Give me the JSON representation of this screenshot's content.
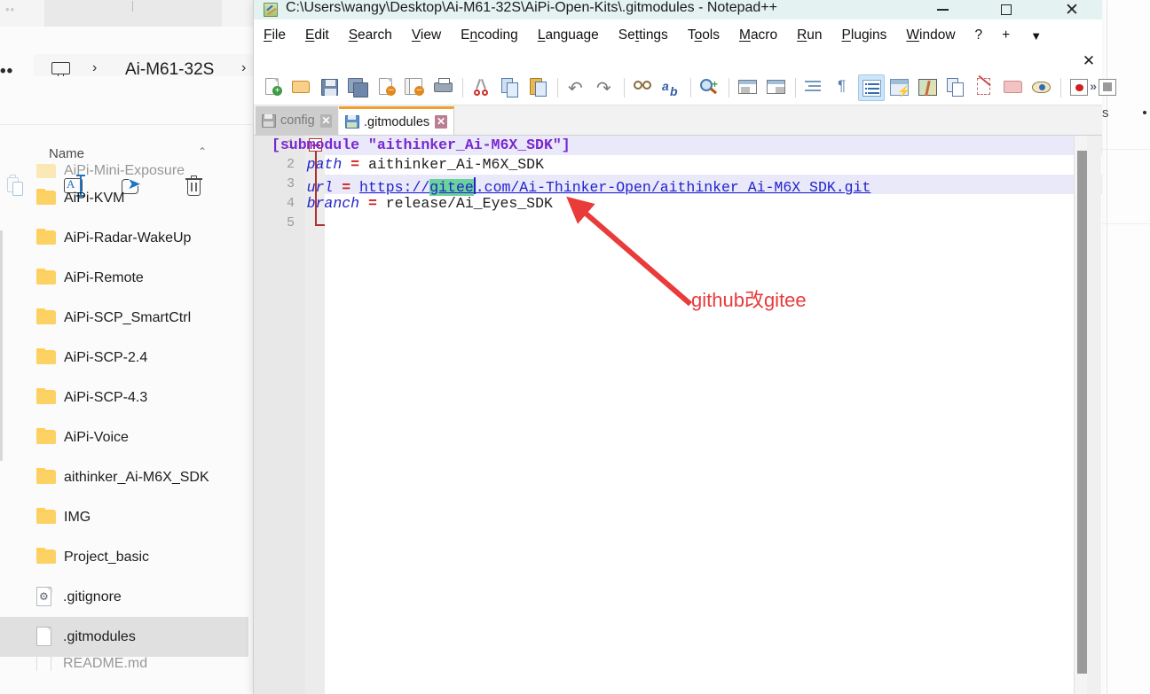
{
  "explorer": {
    "breadcrumb": {
      "overflow_label": "...",
      "monitor_icon": "monitor-icon",
      "current": "Ai-M61-32S",
      "chevron": "›"
    },
    "commands": [
      {
        "name": "paste",
        "icon": "paste-icon"
      },
      {
        "name": "rename",
        "icon": "rename-icon"
      },
      {
        "name": "share",
        "icon": "share-icon"
      },
      {
        "name": "delete",
        "icon": "delete-icon"
      }
    ],
    "column_header": {
      "name_label": "Name",
      "sort_caret": "⌃"
    },
    "items": [
      {
        "label": "AiPi-Mini-Exposure",
        "type": "folder",
        "clipped": true,
        "selected": false
      },
      {
        "label": "AiPi-KVM",
        "type": "folder",
        "selected": false
      },
      {
        "label": "AiPi-Radar-WakeUp",
        "type": "folder",
        "selected": false
      },
      {
        "label": "AiPi-Remote",
        "type": "folder",
        "selected": false
      },
      {
        "label": "AiPi-SCP_SmartCtrl",
        "type": "folder",
        "selected": false
      },
      {
        "label": "AiPi-SCP-2.4",
        "type": "folder",
        "selected": false
      },
      {
        "label": "AiPi-SCP-4.3",
        "type": "folder",
        "selected": false
      },
      {
        "label": "AiPi-Voice",
        "type": "folder",
        "selected": false
      },
      {
        "label": "aithinker_Ai-M6X_SDK",
        "type": "folder",
        "selected": false
      },
      {
        "label": "IMG",
        "type": "folder",
        "selected": false
      },
      {
        "label": "Project_basic",
        "type": "folder",
        "selected": false
      },
      {
        "label": ".gitignore",
        "type": "config-file",
        "selected": false
      },
      {
        "label": ".gitmodules",
        "type": "file",
        "selected": true
      },
      {
        "label": "README.md",
        "type": "file",
        "clipped": true,
        "selected": false
      }
    ]
  },
  "background_right": {
    "text_fragment": "s"
  },
  "notepad": {
    "title": "C:\\Users\\wangy\\Desktop\\Ai-M61-32S\\AiPi-Open-Kits\\.gitmodules - Notepad++",
    "app_icon": "notepadpp-icon",
    "window_buttons": {
      "minimize": "minimize-icon",
      "maximize": "maximize-icon",
      "close": "✕"
    },
    "doc_close_label": "✕",
    "menu": [
      {
        "label": "File",
        "mnemonic": "F"
      },
      {
        "label": "Edit",
        "mnemonic": "E"
      },
      {
        "label": "Search",
        "mnemonic": "S"
      },
      {
        "label": "View",
        "mnemonic": "V"
      },
      {
        "label": "Encoding",
        "mnemonic": "n"
      },
      {
        "label": "Language",
        "mnemonic": "L"
      },
      {
        "label": "Settings",
        "mnemonic": "t"
      },
      {
        "label": "Tools",
        "mnemonic": "o"
      },
      {
        "label": "Macro",
        "mnemonic": "M"
      },
      {
        "label": "Run",
        "mnemonic": "R"
      },
      {
        "label": "Plugins",
        "mnemonic": "P"
      },
      {
        "label": "Window",
        "mnemonic": "W"
      },
      {
        "label": "?",
        "mnemonic": ""
      },
      {
        "label": "+",
        "mnemonic": ""
      }
    ],
    "menu_caret": "▼",
    "toolbar": {
      "overflow_label": "»",
      "buttons": [
        {
          "name": "new-file-icon"
        },
        {
          "name": "open-file-icon"
        },
        {
          "name": "save-icon"
        },
        {
          "name": "save-all-icon"
        },
        {
          "name": "close-file-icon"
        },
        {
          "name": "close-all-files-icon"
        },
        {
          "name": "print-icon"
        },
        {
          "name": "cut-icon"
        },
        {
          "name": "copy-icon"
        },
        {
          "name": "paste-icon"
        },
        {
          "name": "undo-icon"
        },
        {
          "name": "redo-icon"
        },
        {
          "name": "find-icon"
        },
        {
          "name": "replace-icon"
        },
        {
          "name": "zoom-in-icon"
        },
        {
          "name": "zoom-out-icon"
        },
        {
          "name": "sync-vertical-icon"
        },
        {
          "name": "sync-horizontal-icon"
        },
        {
          "name": "word-wrap-icon"
        },
        {
          "name": "show-all-chars-icon"
        },
        {
          "name": "indent-guide-icon"
        },
        {
          "name": "user-defined-dialog-icon"
        },
        {
          "name": "document-map-icon"
        },
        {
          "name": "function-list-icon"
        },
        {
          "name": "document-switcher-icon"
        },
        {
          "name": "folder-as-workspace-icon"
        },
        {
          "name": "monitoring-icon"
        },
        {
          "name": "record-macro-icon"
        },
        {
          "name": "stop-macro-icon"
        }
      ]
    },
    "tabs": [
      {
        "label": "config",
        "active": false,
        "close": "✕"
      },
      {
        "label": ".gitmodules",
        "active": true,
        "close": "✕"
      }
    ],
    "editor": {
      "line_numbers": [
        "1",
        "2",
        "3",
        "4",
        "5"
      ],
      "lines": [
        {
          "n": 1,
          "kind": "section",
          "text": "[submodule \"aithinker_Ai-M6X_SDK\"]",
          "highlight": false
        },
        {
          "n": 2,
          "kind": "keyvalue",
          "key": "path",
          "eq": "=",
          "value": "aithinker_Ai-M6X_SDK",
          "highlight": false
        },
        {
          "n": 3,
          "kind": "url",
          "key": "url",
          "eq": "=",
          "url_prefix": "https://",
          "url_match": "gitee",
          "url_suffix": ".com/Ai-Thinker-Open/aithinker_Ai-M6X_SDK.git",
          "highlight": true
        },
        {
          "n": 4,
          "kind": "keyvalue",
          "key": "branch",
          "eq": "=",
          "value": "release/Ai_Eyes_SDK",
          "highlight": false
        },
        {
          "n": 5,
          "kind": "blank",
          "text": "",
          "highlight": false
        }
      ],
      "fold_marker": "collapse-icon",
      "annotation": {
        "text": "github改gitee",
        "color": "#ea3b3b",
        "arrow": "red-arrow-icon"
      }
    }
  }
}
